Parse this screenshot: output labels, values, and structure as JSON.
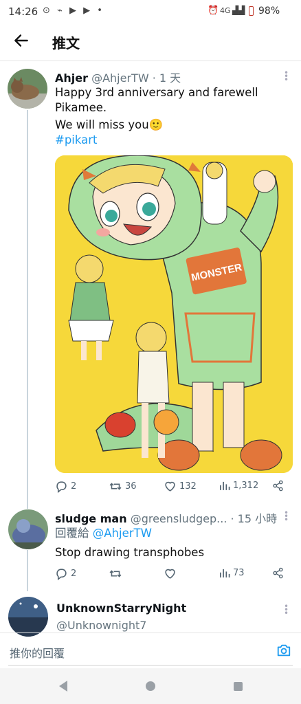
{
  "status": {
    "time": "14:26",
    "network": "4G",
    "battery": "98%"
  },
  "header": {
    "title": "推文"
  },
  "tweet": {
    "name": "Ahjer",
    "handle": "@AhjerTW",
    "time": "· 1 天",
    "line1": "Happy 3rd anniversary and farewell",
    "line2": "Pikamee.",
    "line3": "We will miss you🙂",
    "hashtag": "#pikart",
    "art_text": "MONSTER",
    "stats": {
      "replies": "2",
      "retweets": "36",
      "likes": "132",
      "views": "1,312"
    }
  },
  "reply1": {
    "name": "sludge man",
    "handle": "@greensludgep...",
    "time": "· 15 小時",
    "replying_prefix": "回覆給",
    "replying_to": "@AhjerTW",
    "text": "Stop drawing transphobes",
    "stats": {
      "replies": "2",
      "views": "73"
    }
  },
  "reply2": {
    "name": "UnknownStarryNight",
    "handle": "@Unknownight7"
  },
  "compose": {
    "placeholder": "推你的回覆"
  },
  "colors": {
    "link": "#1d9bf0",
    "art_background": "#f6d83a",
    "hoodie": "#a9dfa0"
  }
}
